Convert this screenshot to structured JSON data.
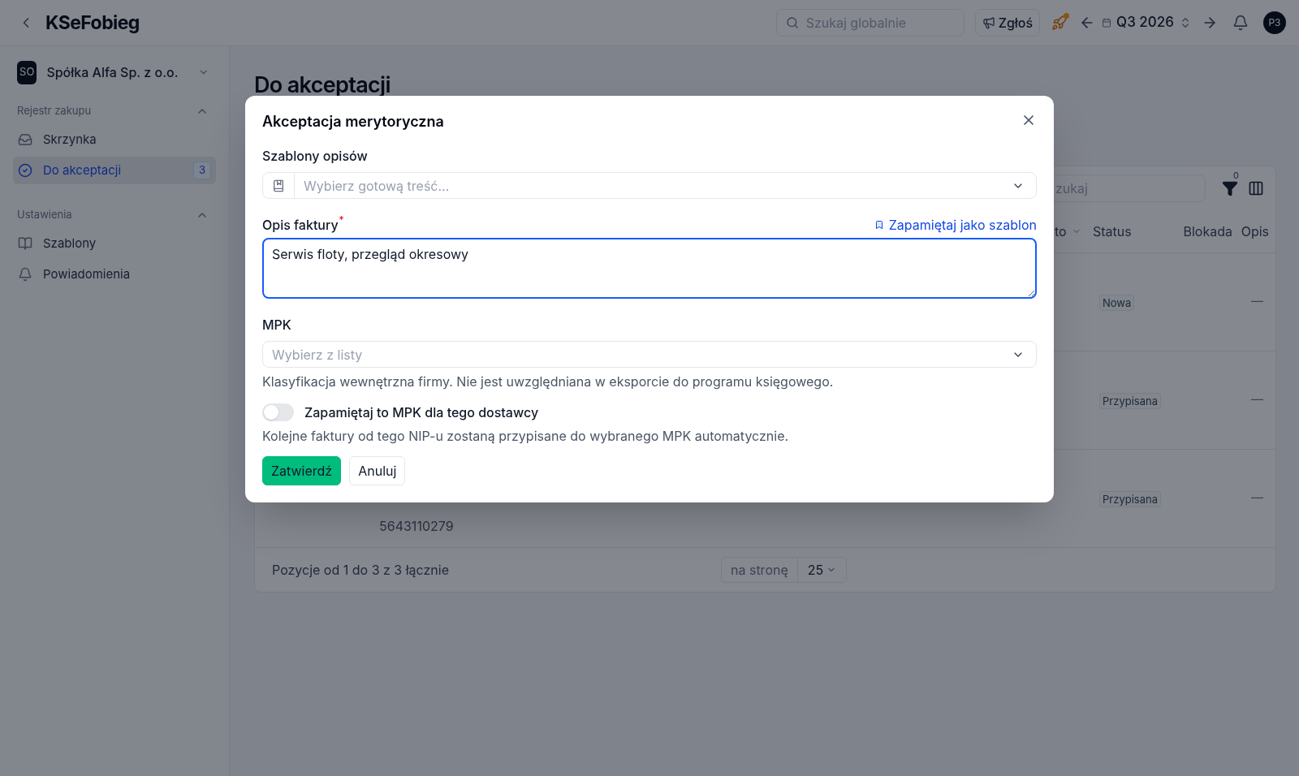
{
  "app": {
    "title": "KSeFobieg"
  },
  "topbar": {
    "search": {
      "placeholder": "Szukaj globalnie"
    },
    "report_button": "Zgłoś",
    "period": "Q3 2026",
    "avatar": "P3"
  },
  "sidebar": {
    "company": {
      "initials": "SO",
      "name": "Spółka Alfa Sp. z o.o."
    },
    "sections": [
      {
        "title": "Rejestr zakupu",
        "expanded": true,
        "items": [
          {
            "label": "Skrzynka",
            "selected": false
          },
          {
            "label": "Do akceptacji",
            "selected": true,
            "count": "3"
          }
        ]
      },
      {
        "title": "Ustawienia",
        "expanded": true,
        "items": [
          {
            "label": "Szablony",
            "selected": false
          },
          {
            "label": "Powiadomienia",
            "selected": false
          }
        ]
      }
    ]
  },
  "page": {
    "title": "Do akceptacji",
    "table": {
      "search": {
        "placeholder": "zukaj"
      },
      "filter_count": "0",
      "columns": [
        "to",
        "Status",
        "Blokada",
        "Opis"
      ],
      "rows": [
        {
          "status": "Nowa",
          "opis": "—"
        },
        {
          "status": "Przypisana",
          "opis": "—"
        },
        {
          "status": "Przypisana",
          "opis": "—",
          "nip": "5643110279"
        }
      ],
      "footer": {
        "summary": "Pozycje od 1 do 3 z 3 łącznie",
        "per_page_label": "na stronę",
        "per_page": "25"
      }
    }
  },
  "dialog": {
    "title": "Akceptacja merytoryczna",
    "template": {
      "label": "Szablony opisów",
      "placeholder": "Wybierz gotową treść..."
    },
    "description": {
      "label": "Opis faktury",
      "required_mark": "*",
      "value": "Serwis floty, przegląd okresowy",
      "save_link": "Zapamiętaj jako szablon"
    },
    "mpk": {
      "label": "MPK",
      "placeholder": "Wybierz z listy",
      "help": "Klasyfikacja wewnętrzna firmy. Nie jest uwzględniana w eksporcie do programu księgowego."
    },
    "remember": {
      "label": "Zapamiętaj to MPK dla tego dostawcy",
      "on": false,
      "help": "Kolejne faktury od tego NIP-u zostaną przypisane do wybranego MPK automatycznie."
    },
    "buttons": [
      {
        "label": "Zatwierdź",
        "kind": "primary"
      },
      {
        "label": "Anuluj",
        "kind": "secondary"
      }
    ]
  }
}
